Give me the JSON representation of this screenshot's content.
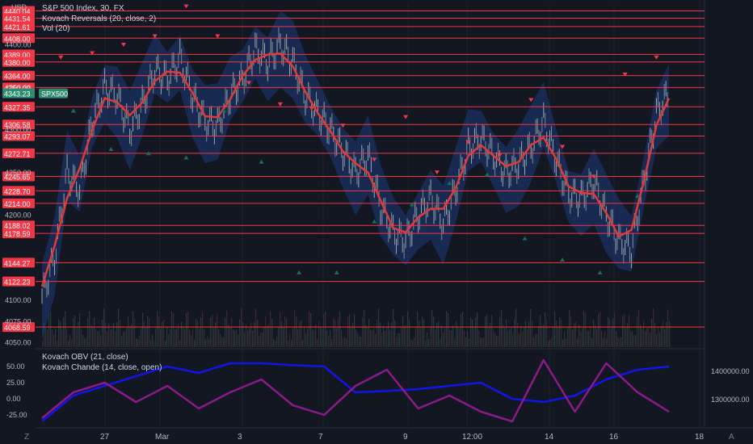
{
  "chart_data": [
    {
      "type": "line",
      "title": "S&P 500 Index, 30, FX",
      "indicators": [
        "Kovach Reversals (20, close, 2)",
        "Vol (20)"
      ],
      "currency": "USD",
      "symbol_tag": "SPX500",
      "last_price": "4343.23",
      "ylim": [
        4045,
        4450
      ],
      "y_ticks": [
        "4100.00",
        "4075.00",
        "4050.00",
        "4200.00",
        "4250.00",
        "4300.00",
        "4350.00",
        "4400.00"
      ],
      "x_labels": [
        "27",
        "Mar",
        "3",
        "7",
        "9",
        "12:00",
        "14",
        "16",
        "18"
      ],
      "level_lines": [
        4440.04,
        4431.54,
        4421.61,
        4408.0,
        4389.0,
        4380.0,
        4364.0,
        4350.0,
        4327.35,
        4306.58,
        4293.07,
        4272.71,
        4245.65,
        4228.7,
        4214.0,
        4188.02,
        4178.59,
        4144.27,
        4122.23,
        4068.59
      ],
      "level_labels": [
        "4440.04",
        "4431.54",
        "4421.61",
        "4408.00",
        "4389.00",
        "4380.00",
        "4364.00",
        "4350.00",
        "4327.35",
        "4306.58",
        "4293.07",
        "4272.71",
        "4245.65",
        "4228.70",
        "4214.00",
        "4188.02",
        "4178.59",
        "4144.27",
        "4122.23",
        "4068.59"
      ],
      "price_series": {
        "x": [
          0,
          2,
          4,
          6,
          8,
          10,
          12,
          14,
          16,
          18,
          20,
          22,
          24,
          26,
          28,
          30,
          32,
          34,
          36,
          38,
          40,
          42,
          44,
          46,
          48,
          50,
          52,
          54,
          56,
          58,
          60,
          62,
          64,
          66,
          68,
          70,
          72,
          74,
          76,
          78,
          80,
          82,
          84,
          86,
          88,
          90,
          92,
          94,
          96,
          98,
          100
        ],
        "close": [
          4105,
          4150,
          4250,
          4230,
          4310,
          4350,
          4340,
          4300,
          4330,
          4370,
          4360,
          4385,
          4340,
          4310,
          4305,
          4340,
          4360,
          4395,
          4380,
          4400,
          4380,
          4340,
          4320,
          4300,
          4275,
          4250,
          4270,
          4210,
          4180,
          4170,
          4200,
          4220,
          4190,
          4230,
          4280,
          4290,
          4270,
          4250,
          4260,
          4280,
          4310,
          4265,
          4225,
          4220,
          4240,
          4200,
          4170,
          4160,
          4240,
          4320,
          4343
        ]
      },
      "sell_markers": [
        4380,
        4385,
        4395,
        4405,
        4440,
        4405,
        4350,
        4325,
        4320,
        4300,
        4260,
        4310,
        4245,
        4280,
        4265,
        4330,
        4275,
        4240,
        4360,
        4380
      ],
      "buy_markers": [
        4330,
        4285,
        4280,
        4275,
        4330,
        4270,
        4140,
        4140,
        4200,
        4220,
        4245,
        4255,
        4180,
        4155,
        4140,
        4230
      ]
    },
    {
      "type": "line",
      "title": "Kovach OBV (21, close)",
      "subtitle": "Kovach Chande (14, close, open)",
      "left_ticks": [
        "50.00",
        "25.00",
        "0.00",
        "-25.00"
      ],
      "right_ticks": [
        "1400000.00",
        "1300000.00"
      ],
      "series": [
        {
          "color": "#1414e6",
          "x": [
            0,
            5,
            10,
            15,
            20,
            25,
            30,
            35,
            40,
            45,
            50,
            55,
            60,
            65,
            70,
            75,
            80,
            85,
            90,
            95,
            100
          ],
          "values": [
            -35,
            5,
            20,
            35,
            50,
            40,
            55,
            55,
            52,
            50,
            10,
            12,
            15,
            20,
            25,
            0,
            -5,
            5,
            30,
            45,
            50
          ]
        },
        {
          "color": "#8b1a89",
          "x": [
            0,
            5,
            10,
            15,
            20,
            25,
            30,
            35,
            40,
            45,
            50,
            55,
            60,
            65,
            70,
            75,
            80,
            85,
            90,
            95,
            100
          ],
          "values": [
            -30,
            10,
            25,
            -5,
            20,
            -15,
            10,
            30,
            -10,
            -25,
            20,
            45,
            -15,
            5,
            -20,
            -35,
            60,
            -20,
            55,
            10,
            -20
          ]
        }
      ]
    }
  ],
  "colors": {
    "background": "#131722",
    "level_line": "#f23645",
    "price_badge": "#f23645",
    "ma_line": "#e03a3a",
    "band_fill": "#1f3a7a",
    "symbol_badge": "#2e8b6d",
    "obv_line": "#1414e6",
    "chande_line": "#8b1a89"
  },
  "ui": {
    "zoom_icon": "Z",
    "auto_icon": "A"
  }
}
